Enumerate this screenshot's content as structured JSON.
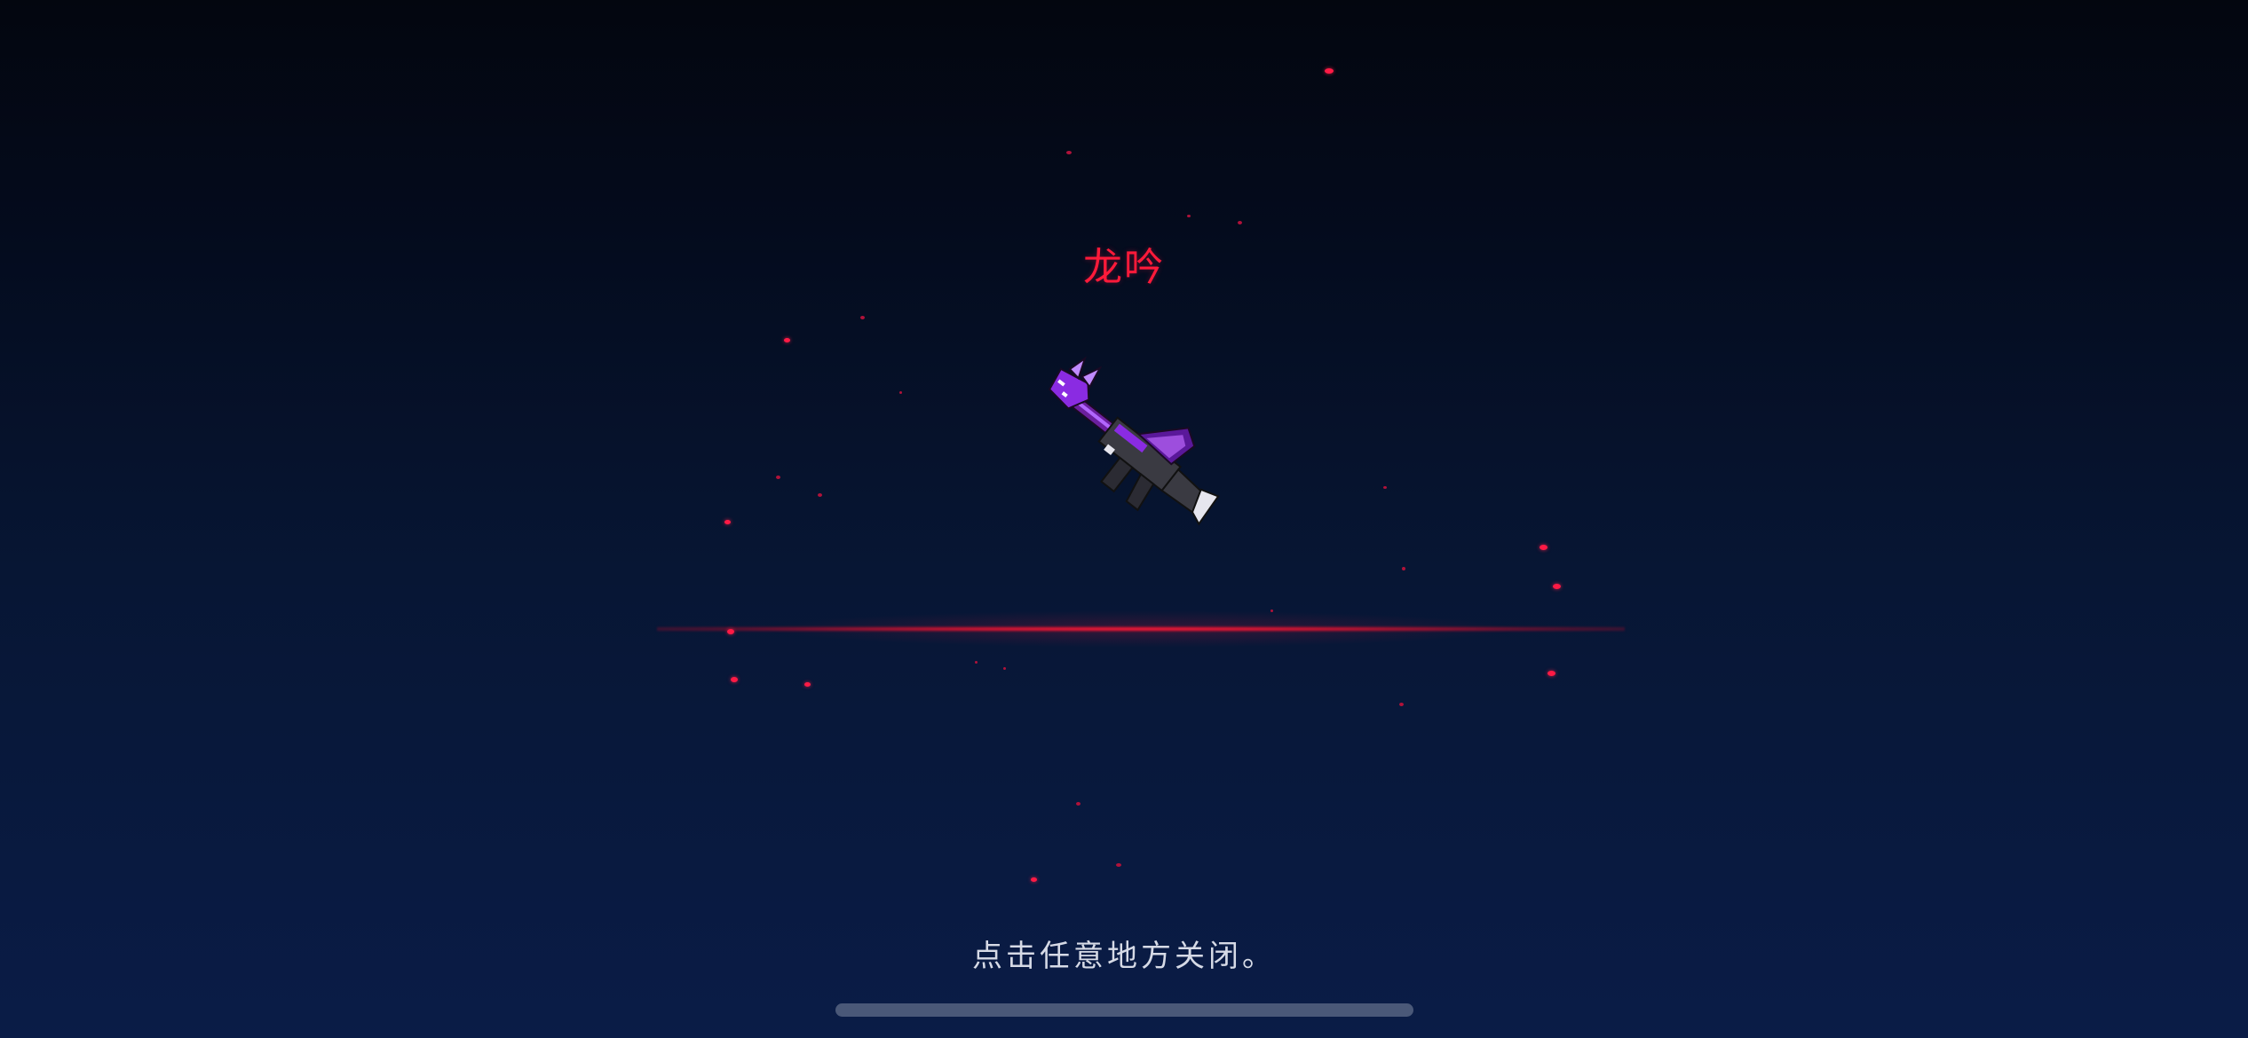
{
  "reward_popup": {
    "item_name": "龙吟",
    "close_hint": "点击任意地方关闭。"
  },
  "weapon_sprite": {
    "icon": "dragon-rifle-weapon-icon",
    "primary_color": "#8a2be2",
    "secondary_color": "#5a189a",
    "metal_color": "#3a3a42",
    "accent_color": "#ff1a3a"
  },
  "colors": {
    "title": "#ff1a3a",
    "hint": "#d6dae6",
    "glow_line": "#ff1e3c",
    "particles": "#ff1a45",
    "background_top": "#03060f",
    "background_bottom": "#0a1c47"
  }
}
